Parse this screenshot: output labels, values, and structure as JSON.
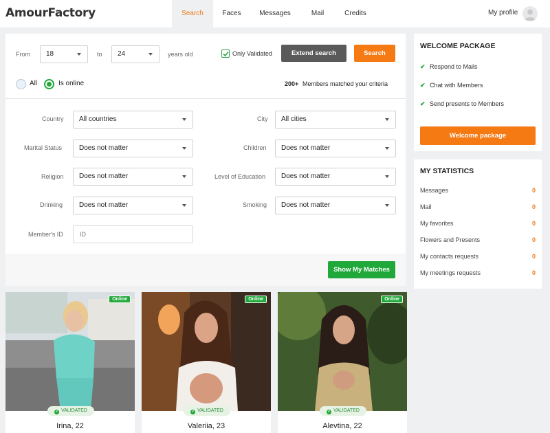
{
  "header": {
    "logo": "AmourFactory",
    "nav": [
      "Search",
      "Faces",
      "Messages",
      "Mail",
      "Credits"
    ],
    "profile_label": "My profile"
  },
  "search": {
    "from_label": "From",
    "age_from": "18",
    "to_label": "to",
    "age_to": "24",
    "years_label": "years old",
    "only_validated_label": "Only Validated",
    "extend_search_label": "Extend search",
    "search_label": "Search",
    "radio_all": "All",
    "radio_online": "Is online",
    "match_count": "200+",
    "match_text": "Members matched your criteria",
    "filters": {
      "country_label": "Country",
      "country_value": "All countries",
      "city_label": "City",
      "city_value": "All cities",
      "marital_label": "Marital Status",
      "marital_value": "Does not matter",
      "children_label": "Children",
      "children_value": "Does not matter",
      "religion_label": "Religion",
      "religion_value": "Does not matter",
      "education_label": "Level of Education",
      "education_value": "Does not matter",
      "drinking_label": "Drinking",
      "drinking_value": "Does not matter",
      "smoking_label": "Smoking",
      "smoking_value": "Does not matter",
      "member_id_label": "Member's ID",
      "member_id_placeholder": "ID"
    },
    "show_matches_label": "Show My Matches"
  },
  "welcome": {
    "title": "WELCOME PACKAGE",
    "items": [
      "Respond to Mails",
      "Chat with Members",
      "Send presents to Members"
    ],
    "button_label": "Welcome package"
  },
  "stats": {
    "title": "MY STATISTICS",
    "rows": [
      {
        "label": "Messages",
        "value": "0"
      },
      {
        "label": "Mail",
        "value": "0"
      },
      {
        "label": "My favorites",
        "value": "0"
      },
      {
        "label": "Flowers and Presents",
        "value": "0"
      },
      {
        "label": "My contacts requests",
        "value": "0"
      },
      {
        "label": "My meetings requests",
        "value": "0"
      }
    ]
  },
  "profiles": [
    {
      "name": "Irina, 22",
      "online": "Online",
      "validated": "VALIDATED"
    },
    {
      "name": "Valeriia, 23",
      "online": "Online",
      "validated": "VALIDATED"
    },
    {
      "name": "Alevtina, 22",
      "online": "Online",
      "validated": "VALIDATED"
    }
  ],
  "colors": {
    "accent": "#f57a14",
    "green": "#21a83a",
    "stat_value": "#f07a1a"
  }
}
